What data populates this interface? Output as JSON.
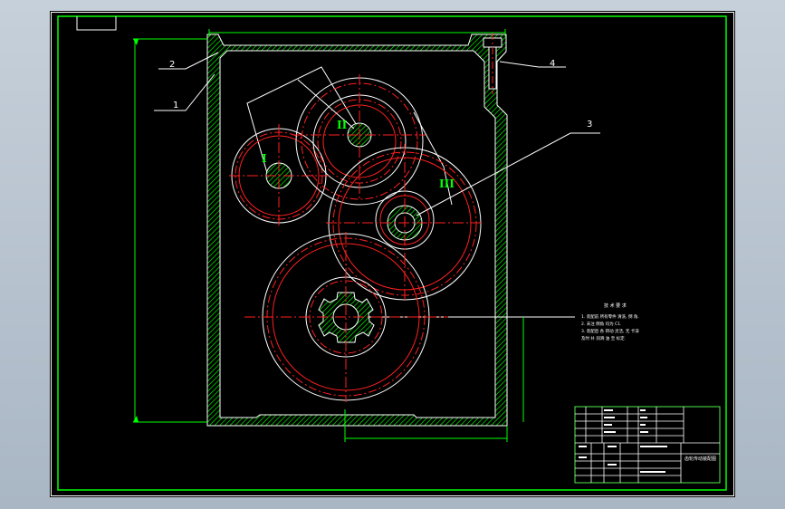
{
  "colors": {
    "background": "#000000",
    "frame": "#00ff00",
    "dimension": "#00ff00",
    "center_line": "#ff0000",
    "outline": "#ffffff",
    "gear_pitch": "#ff2020",
    "leader": "#ffffff",
    "roman": "#00ff00"
  },
  "leaders": [
    {
      "label": "1"
    },
    {
      "label": "2"
    },
    {
      "label": "3"
    },
    {
      "label": "4"
    }
  ],
  "shafts": [
    "I",
    "II",
    "III"
  ],
  "tech_notes": {
    "title": "技 术 要 求",
    "lines": [
      "1. 装配前 所有零件 清洗, 倒 角.",
      "2. 未注 倒角 均为 C1.",
      "3. 装配后 各 转动 灵活, 无 卡滞",
      "及时 补 润滑 油 至 标定."
    ]
  },
  "title_block": {
    "drawing_name": "齿轮传动装配图"
  }
}
